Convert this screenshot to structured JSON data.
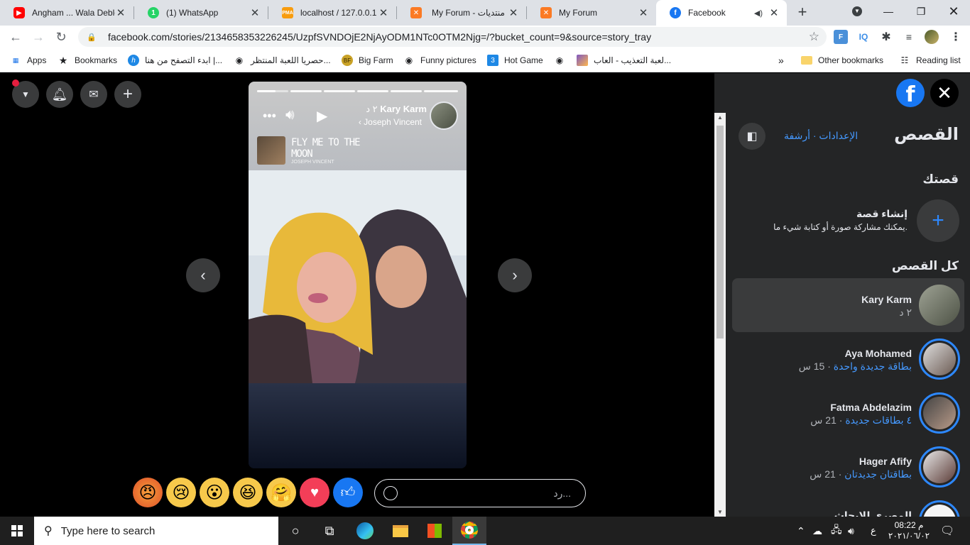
{
  "browser": {
    "tabs": [
      {
        "title": "Angham ... Wala Deble",
        "icon": "youtube-icon",
        "color": "#ff0000"
      },
      {
        "title": "(1) WhatsApp",
        "icon": "whatsapp-icon",
        "color": "#25d366"
      },
      {
        "title": "localhost / 127.0.0.1 /",
        "icon": "phpmyadmin-icon",
        "color": "#f89c0e"
      },
      {
        "title": "My Forum - منتديات",
        "icon": "xampp-icon",
        "color": "#fb7a24"
      },
      {
        "title": "My Forum",
        "icon": "xampp-icon",
        "color": "#fb7a24"
      },
      {
        "title": "Facebook",
        "icon": "facebook-icon",
        "color": "#1877f2"
      }
    ],
    "url": "facebook.com/stories/2134658353226245/UzpfSVNDOjE2NjAyODM1NTc0OTM2Njg=/?bucket_count=9&source=story_tray",
    "bookmarks": [
      {
        "label": "Apps",
        "icon": "apps-grid-icon"
      },
      {
        "label": "Bookmarks",
        "icon": "star-icon"
      },
      {
        "label": "ابدء التصفح من هنا |...",
        "icon": "h-icon"
      },
      {
        "label": "حصريا اللعبة المنتظر...",
        "icon": "globe-icon"
      },
      {
        "label": "Big Farm",
        "icon": "bigfarm-icon"
      },
      {
        "label": "Funny pictures",
        "icon": "globe-icon"
      },
      {
        "label": "Hot Game",
        "icon": "hotgame-icon"
      },
      {
        "label": "لعبة التعذيب - العاب...",
        "icon": "game-icon"
      },
      {
        "label": "Other bookmarks",
        "icon": "folder-icon"
      },
      {
        "label": "Reading list",
        "icon": "reading-list-icon"
      }
    ]
  },
  "story": {
    "author": "Kary Karm",
    "time": "٢ د",
    "music_artist": "Joseph Vincent",
    "song_title": "FLY ME TO THE MOON",
    "song_sub": "JOSEPH VINCENT",
    "reply_placeholder": "رد...",
    "progress_segments": 6
  },
  "panel": {
    "title": "القصص",
    "archive": "أرشفة",
    "settings": "الإعدادات",
    "your_story": "قصتك",
    "create_title": "إنشاء قصة",
    "create_sub": "يمكنك مشاركة صورة أو كتابة شيء ما.",
    "all_stories": "كل القصص",
    "items": [
      {
        "name": "Kary Karm",
        "badge": "",
        "time": "٢ د"
      },
      {
        "name": "Aya Mohamed",
        "badge": "بطاقة جديدة واحدة",
        "time": "15 س"
      },
      {
        "name": "Fatma Abdelazim",
        "badge": "٤ بطاقات جديدة",
        "time": "21 س"
      },
      {
        "name": "Hager Afify",
        "badge": "بطاقتان جديدتان",
        "time": "21 س"
      },
      {
        "name": "المصري للابحاث",
        "badge": "",
        "time": ""
      }
    ]
  },
  "taskbar": {
    "search_placeholder": "Type here to search",
    "time": "08:22 م",
    "date": "٢٠٢١/٠٦/٠٢",
    "lang": "ع"
  },
  "colors": {
    "accent": "#2d88ff",
    "panel_bg": "#242526",
    "fb_blue": "#1877f2"
  }
}
